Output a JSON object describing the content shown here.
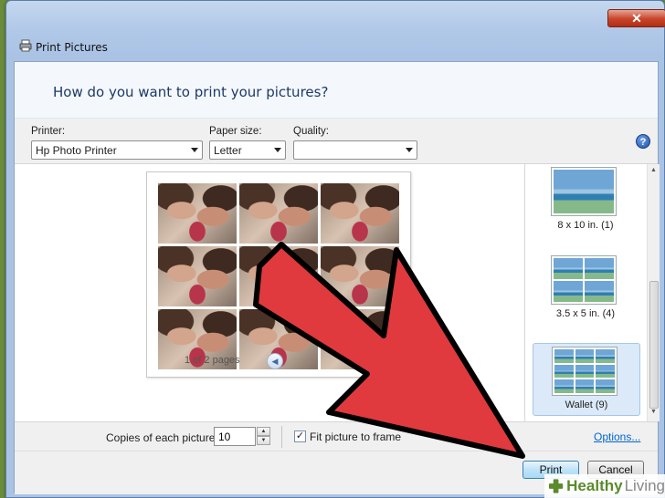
{
  "window": {
    "title": "Print Pictures"
  },
  "header": {
    "question": "How do you want to print your pictures?"
  },
  "controls": {
    "printer_label": "Printer:",
    "printer_value": "Hp Photo Printer",
    "paper_label": "Paper size:",
    "paper_value": "Letter",
    "quality_label": "Quality:",
    "quality_value": ""
  },
  "preview": {
    "page_indicator": "1 of 2 pages"
  },
  "layouts": [
    {
      "label": "8 x 10 in. (1)",
      "selected": false
    },
    {
      "label": "3.5 x 5 in. (4)",
      "selected": false
    },
    {
      "label": "Wallet (9)",
      "selected": true
    }
  ],
  "options": {
    "copies_label": "Copies of each picture:",
    "copies_value": "10",
    "fit_label": "Fit picture to frame",
    "fit_checked": true,
    "options_link": "Options..."
  },
  "footer": {
    "print_label": "Print",
    "cancel_label": "Cancel"
  },
  "watermark": {
    "text_bold": "Healthy",
    "text_light": "Living"
  },
  "colors": {
    "arrow": "#e03a3e",
    "link": "#0066cc",
    "heading": "#1d3a66"
  },
  "icons": [
    "printer-icon",
    "close-icon",
    "help-icon",
    "chevron-left-icon",
    "spinner-up-icon",
    "spinner-down-icon",
    "checkmark-icon"
  ]
}
